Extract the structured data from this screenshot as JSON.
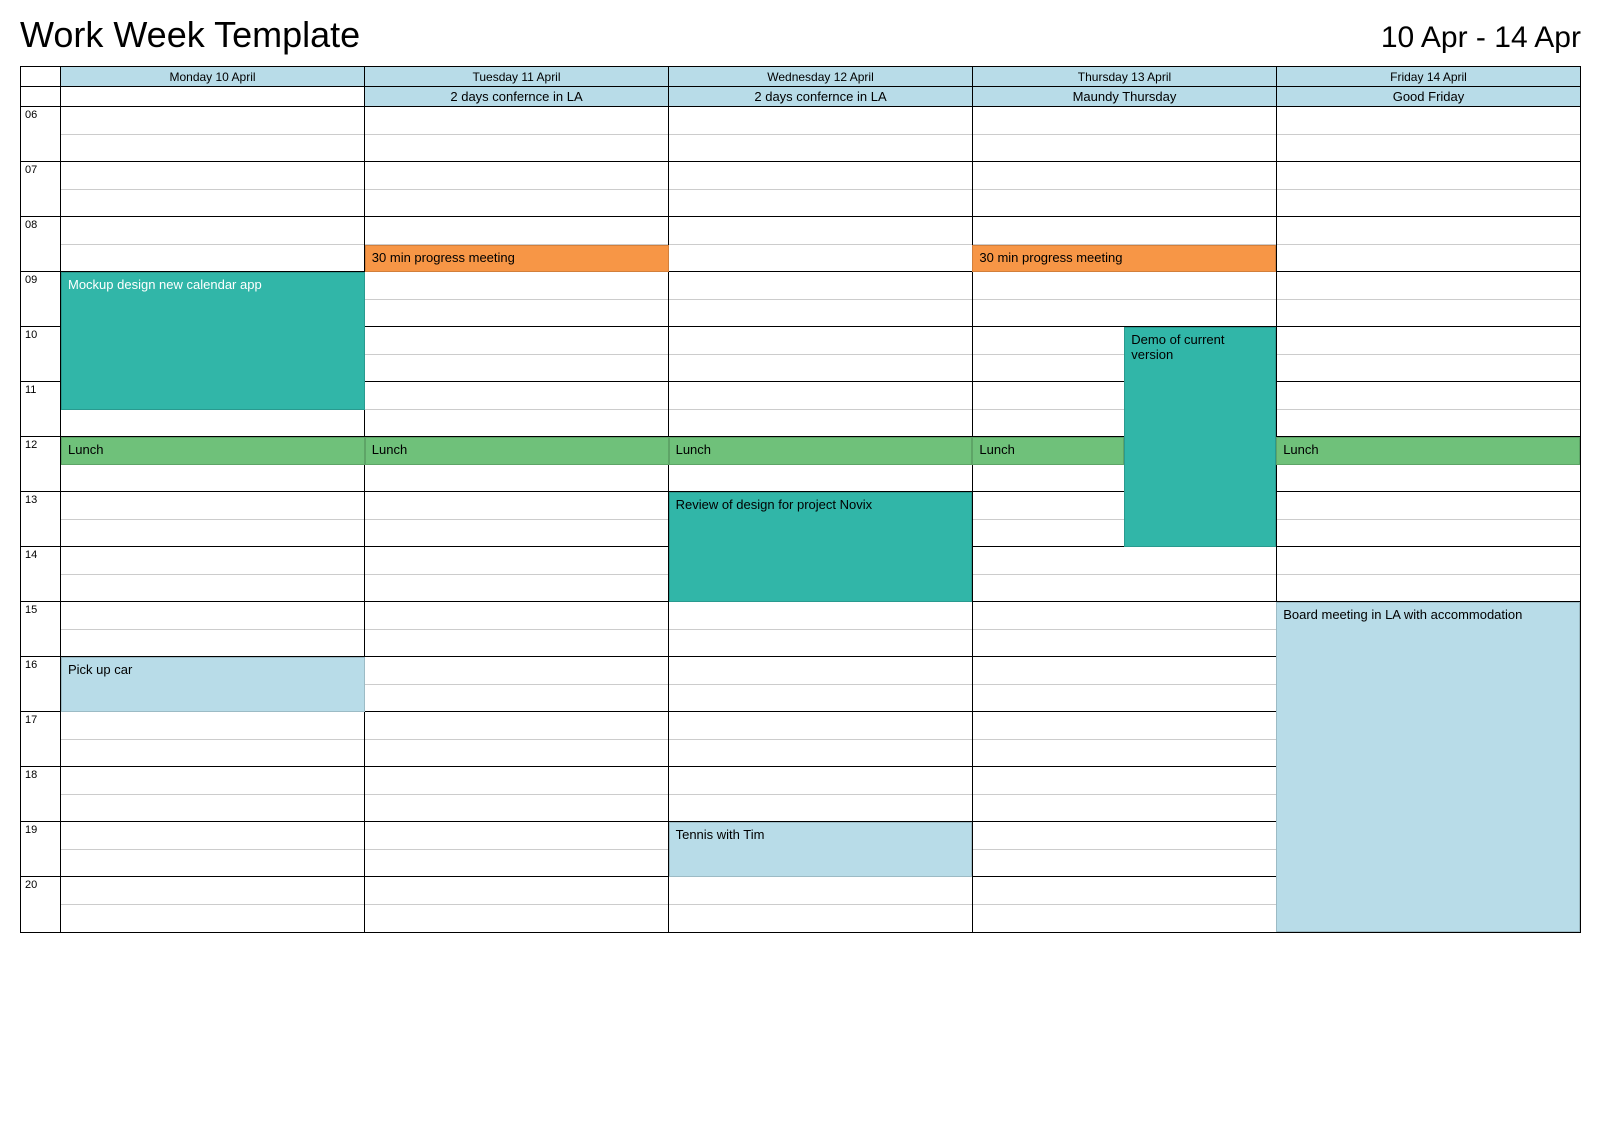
{
  "header": {
    "title": "Work Week Template",
    "date_range": "10 Apr - 14 Apr"
  },
  "hours": [
    "06",
    "07",
    "08",
    "09",
    "10",
    "11",
    "12",
    "13",
    "14",
    "15",
    "16",
    "17",
    "18",
    "19",
    "20"
  ],
  "days": [
    {
      "label": "Monday 10 April",
      "all_day": ""
    },
    {
      "label": "Tuesday 11 April",
      "all_day": "2 days confernce in LA"
    },
    {
      "label": "Wednesday 12 April",
      "all_day": "2 days confernce in LA"
    },
    {
      "label": "Thursday 13 April",
      "all_day": "Maundy Thursday"
    },
    {
      "label": "Friday 14 April",
      "all_day": "Good Friday"
    }
  ],
  "events": [
    {
      "day": 1,
      "start": "08:30",
      "end": "09:00",
      "title": "30 min progress meeting",
      "color": "orange"
    },
    {
      "day": 3,
      "start": "08:30",
      "end": "09:00",
      "title": "30 min progress meeting",
      "color": "orange"
    },
    {
      "day": 0,
      "start": "09:00",
      "end": "11:30",
      "title": "Mockup design new calendar app",
      "color": "teal"
    },
    {
      "day": 0,
      "start": "12:00",
      "end": "12:30",
      "title": "Lunch",
      "color": "green"
    },
    {
      "day": 1,
      "start": "12:00",
      "end": "12:30",
      "title": "Lunch",
      "color": "green"
    },
    {
      "day": 2,
      "start": "12:00",
      "end": "12:30",
      "title": "Lunch",
      "color": "green"
    },
    {
      "day": 3,
      "start": "12:00",
      "end": "12:30",
      "title": "Lunch",
      "color": "green",
      "w": 0.5
    },
    {
      "day": 4,
      "start": "12:00",
      "end": "12:30",
      "title": "Lunch",
      "color": "green"
    },
    {
      "day": 3,
      "start": "10:00",
      "end": "14:00",
      "title": "Demo of current version",
      "color": "teal2",
      "x": 0.5,
      "w": 0.5
    },
    {
      "day": 2,
      "start": "13:00",
      "end": "15:00",
      "title": "Review of design for project Novix",
      "color": "teal2"
    },
    {
      "day": 0,
      "start": "16:00",
      "end": "17:00",
      "title": "Pick up car",
      "color": "blue"
    },
    {
      "day": 2,
      "start": "19:00",
      "end": "20:00",
      "title": "Tennis with Tim",
      "color": "blue"
    },
    {
      "day": 4,
      "start": "15:00",
      "end": "21:00",
      "title": "Board meeting in LA with accommodation",
      "color": "blue"
    }
  ]
}
